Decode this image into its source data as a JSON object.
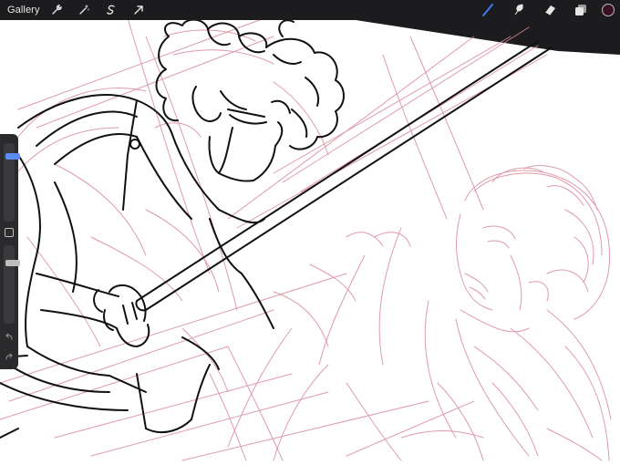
{
  "toolbar": {
    "gallery_label": "Gallery",
    "left_tools": [
      {
        "icon": "wrench-icon",
        "name": "actions"
      },
      {
        "icon": "magic-wand-icon",
        "name": "adjustments"
      },
      {
        "icon": "selection-icon",
        "name": "selection"
      },
      {
        "icon": "transform-arrow-icon",
        "name": "transform"
      }
    ],
    "right_tools": [
      {
        "icon": "brush-icon",
        "name": "brush",
        "active": true
      },
      {
        "icon": "smudge-icon",
        "name": "smudge"
      },
      {
        "icon": "eraser-icon",
        "name": "eraser"
      },
      {
        "icon": "layers-icon",
        "name": "layers"
      }
    ],
    "current_color": "#3a1024"
  },
  "sidebar": {
    "brush_size_level": 0.14,
    "brush_opacity_level": 0.2
  },
  "colors": {
    "toolbar_bg": "#1c1c1e",
    "active_tool": "#3d7bf5",
    "lineart": "#111111",
    "sketch": "#d98a9c",
    "canvas": "#ffffff"
  }
}
